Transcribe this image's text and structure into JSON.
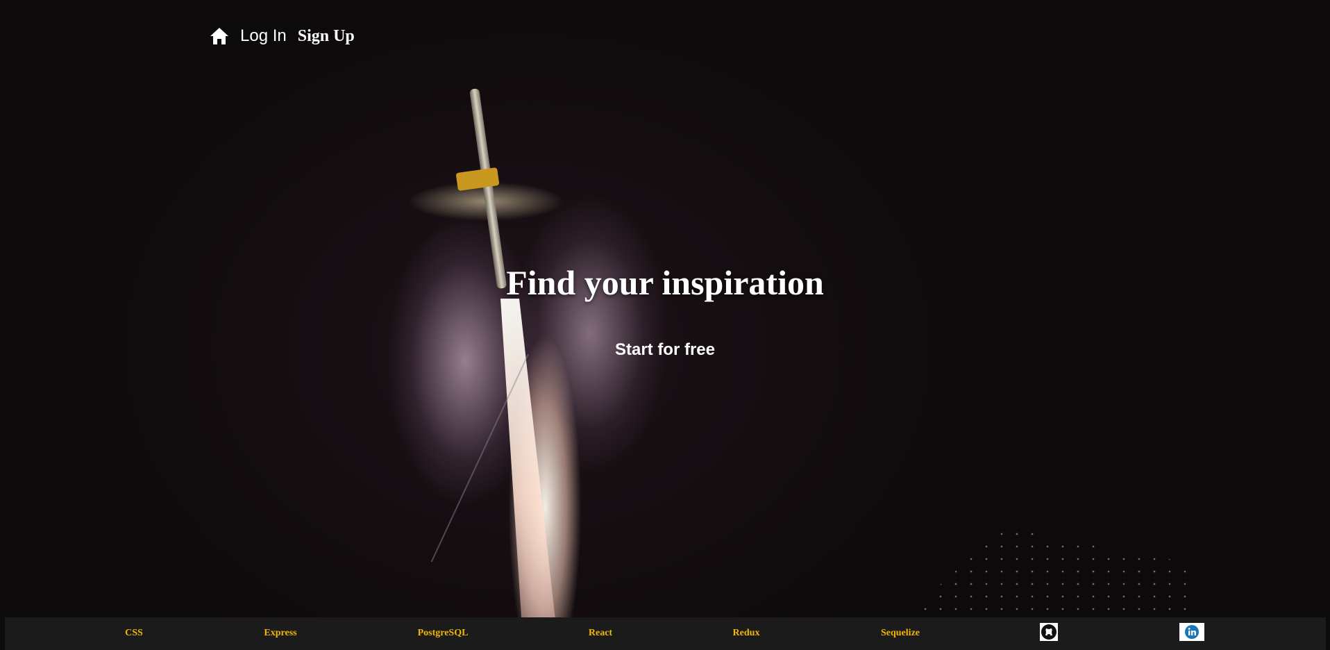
{
  "nav": {
    "home_icon": "home-icon",
    "login_label": "Log In",
    "signup_label": "Sign Up"
  },
  "hero": {
    "headline": "Find your inspiration",
    "cta_label": "Start for free"
  },
  "footer": {
    "links": [
      "CSS",
      "Express",
      "PostgreSQL",
      "React",
      "Redux",
      "Sequelize"
    ],
    "icons": [
      "github-icon",
      "linkedin-icon"
    ],
    "link_color": "#f2b705",
    "background": "#1b1b1b"
  }
}
